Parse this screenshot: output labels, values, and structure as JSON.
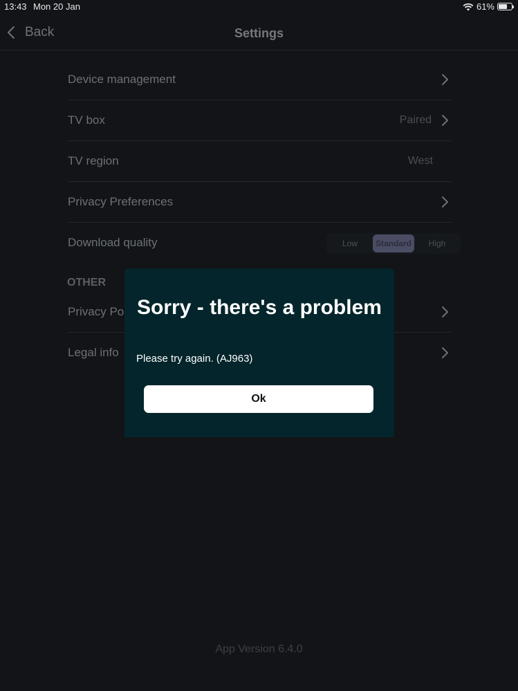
{
  "status": {
    "time": "13:43",
    "date": "Mon 20 Jan",
    "battery": "61%"
  },
  "nav": {
    "back_label": "Back",
    "title": "Settings"
  },
  "settings": [
    {
      "label": "Device management",
      "value": ""
    },
    {
      "label": "TV box",
      "value": "Paired"
    },
    {
      "label": "TV region",
      "value": "West"
    },
    {
      "label": "Privacy Preferences",
      "value": ""
    },
    {
      "label": "Download quality",
      "value": ""
    }
  ],
  "download_quality": {
    "options": [
      "Low",
      "Standard",
      "High"
    ],
    "selected": "Standard"
  },
  "other": {
    "header": "OTHER",
    "items": [
      {
        "label": "Privacy Policy"
      },
      {
        "label": "Legal info"
      }
    ]
  },
  "app_version": "App Version 6.4.0",
  "dialog": {
    "title": "Sorry - there's a problem",
    "message": "Please try again. (AJ963)",
    "ok_label": "Ok"
  },
  "colors": {
    "background": "#121417",
    "dialog_bg": "#03252b",
    "button_bg": "#ffffff"
  }
}
